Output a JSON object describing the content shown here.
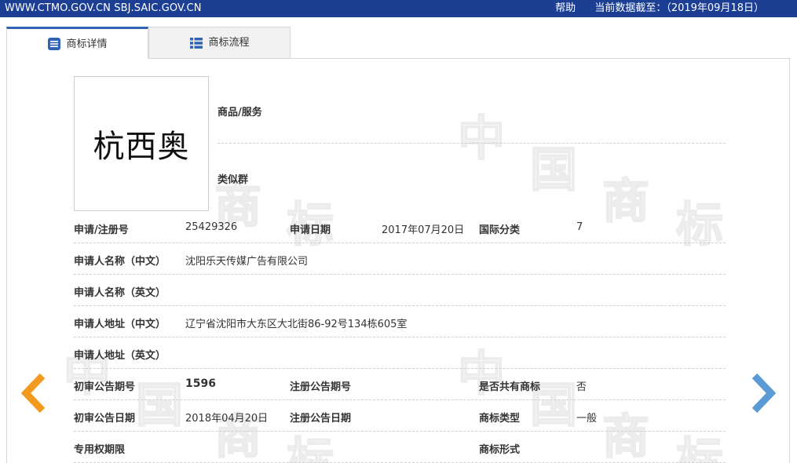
{
  "topbar": {
    "site": "WWW.CTMO.GOV.CN SBJ.SAIC.GOV.CN",
    "help": "帮助",
    "data_date": "当前数据截至：（2019年09月18日）"
  },
  "tabs": [
    {
      "label": "商标详情",
      "icon": "list-doc-icon",
      "active": true
    },
    {
      "label": "商标流程",
      "icon": "list-grid-icon",
      "active": false
    }
  ],
  "trademark": {
    "image_text": "杭西奥",
    "goods_label": "商品/服务",
    "similar_group_label": "类似群"
  },
  "fields": {
    "reg_no_label": "申请/注册号",
    "reg_no": "25429326",
    "app_date_label": "申请日期",
    "app_date": "2017年07月20日",
    "intl_class_label": "国际分类",
    "intl_class": "7",
    "applicant_cn_label": "申请人名称（中文）",
    "applicant_cn": "沈阳乐天传媒广告有限公司",
    "applicant_en_label": "申请人名称（英文）",
    "address_cn_label": "申请人地址（中文）",
    "address_cn": "辽宁省沈阳市大东区大北街86-92号134栋605室",
    "address_en_label": "申请人地址（英文）",
    "prelim_pub_no_label": "初审公告期号",
    "prelim_pub_no": "1596",
    "reg_pub_no_label": "注册公告期号",
    "shared_label": "是否共有商标",
    "shared": "否",
    "prelim_pub_date_label": "初审公告日期",
    "prelim_pub_date": "2018年04月20日",
    "reg_pub_date_label": "注册公告日期",
    "tm_type_label": "商标类型",
    "tm_type": "一般",
    "exclusive_period_label": "专用权期限",
    "tm_form_label": "商标形式"
  },
  "watermark": {
    "chars": [
      "中",
      "国",
      "商",
      "标"
    ]
  },
  "colors": {
    "topbar": "#1c3f94",
    "tab_accent": "#2f64b3",
    "prev_arrow": "#f39a1e",
    "next_arrow": "#5a9bd5"
  }
}
